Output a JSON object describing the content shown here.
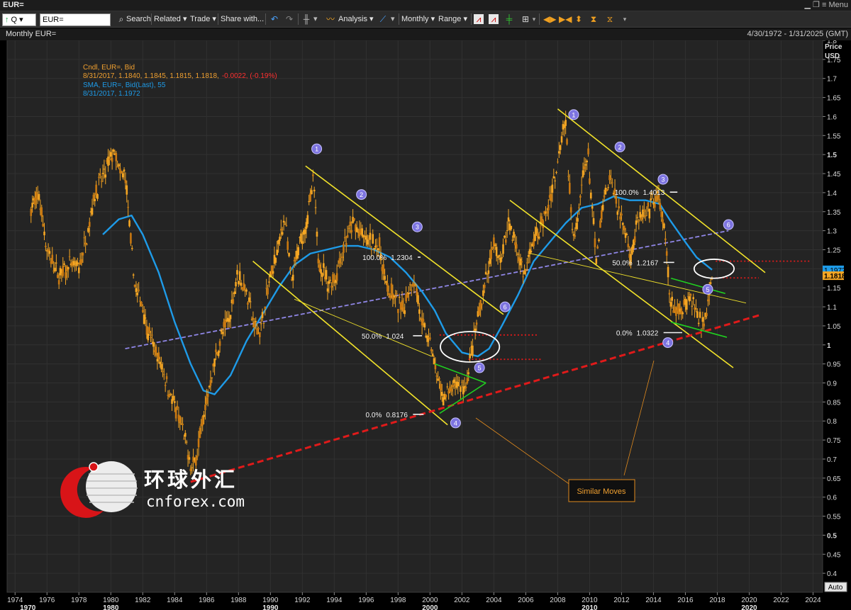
{
  "window": {
    "title": "EUR=",
    "menu_label": "Menu"
  },
  "toolbar": {
    "ric_value": "EUR=",
    "search_label": "Search",
    "related_label": "Related",
    "trade_label": "Trade",
    "share_label": "Share with...",
    "analysis_label": "Analysis",
    "interval_label": "Monthly",
    "range_label": "Range"
  },
  "panel": {
    "title": "Monthly EUR=",
    "date_range": "4/30/1972 - 1/31/2025 (GMT)",
    "auto_label": "Auto"
  },
  "legend": {
    "line1": "Cndl, EUR=, Bid",
    "line2_prefix": "8/31/2017, 1.1840, 1.1845, 1.1815, 1.1818,",
    "line2_change": "-0.0022, (-0.19%)",
    "line3": "SMA, EUR=, Bid(Last),  55",
    "line4": "8/31/2017, 1.1972"
  },
  "colors": {
    "background": "#000000",
    "plot_bg": "#242424",
    "price_series": "#f5a623",
    "sma_series": "#1e9be8",
    "channel": "#f2e32a",
    "support": "#e01a1a",
    "midline": "#8f86e6",
    "wedge": "#20d020",
    "wave_badge": "#7d74e0",
    "callout": "#e08a1e"
  },
  "watermark": {
    "chinese": "环球外汇",
    "latin": "cnforex.com"
  },
  "callout": {
    "label": "Similar Moves"
  },
  "chart_data": {
    "type": "candlestick",
    "interval": "monthly",
    "ylabel": "Price",
    "yunit": "USD",
    "ylim": [
      0.35,
      1.8
    ],
    "xlim": [
      1973.5,
      2024.6
    ],
    "y_ticks": [
      0.4,
      0.45,
      0.5,
      0.55,
      0.6,
      0.65,
      0.7,
      0.75,
      0.8,
      0.85,
      0.9,
      0.95,
      1,
      1.05,
      1.1,
      1.15,
      1.2,
      1.25,
      1.3,
      1.35,
      1.4,
      1.45,
      1.5,
      1.55,
      1.6,
      1.65,
      1.7,
      1.75,
      1.8
    ],
    "y_tick_labels": [
      "0.4",
      "0.45",
      "0.5",
      "0.55",
      "0.6",
      "0.65",
      "0.7",
      "0.75",
      "0.8",
      "0.85",
      "0.9",
      "0.95",
      "1",
      "1.05",
      "1.1",
      "1.15",
      "1.2",
      "1.25",
      "1.3",
      "1.35",
      "1.4",
      "1.45",
      "1.5",
      "1.55",
      "1.6",
      "1.65",
      "1.7",
      "1.75",
      "1.8"
    ],
    "y_bold_ticks": [
      0.5,
      1,
      1.5
    ],
    "x_ticks": [
      1974,
      1976,
      1978,
      1980,
      1982,
      1984,
      1986,
      1988,
      1990,
      1992,
      1994,
      1996,
      1998,
      2000,
      2002,
      2004,
      2006,
      2008,
      2010,
      2012,
      2014,
      2016,
      2018,
      2020,
      2022,
      2024
    ],
    "x_tick_labels": [
      "1974",
      "1976",
      "1978",
      "1980",
      "1982",
      "1984",
      "1986",
      "1988",
      "1990",
      "1992",
      "1994",
      "1996",
      "1998",
      "2000",
      "2002",
      "2004",
      "2006",
      "2008",
      "2010",
      "2012",
      "2014",
      "2016",
      "2018",
      "2020",
      "2022",
      "2024"
    ],
    "x_major": [
      {
        "x": 1970,
        "label": "1970",
        "at": 1974.8
      },
      {
        "x": 1980,
        "label": "1980"
      },
      {
        "x": 1990,
        "label": "1990"
      },
      {
        "x": 2000,
        "label": "2000"
      },
      {
        "x": 2010,
        "label": "2010"
      },
      {
        "x": 2020,
        "label": "2020"
      }
    ],
    "series": [
      {
        "name": "EUR=",
        "kind": "candle",
        "points": [
          [
            1975.0,
            1.36
          ],
          [
            1975.5,
            1.39
          ],
          [
            1976.0,
            1.25
          ],
          [
            1976.7,
            1.18
          ],
          [
            1977.5,
            1.21
          ],
          [
            1978.0,
            1.2
          ],
          [
            1978.5,
            1.29
          ],
          [
            1979.0,
            1.4
          ],
          [
            1979.5,
            1.44
          ],
          [
            1979.8,
            1.47
          ],
          [
            1980.2,
            1.51
          ],
          [
            1980.6,
            1.44
          ],
          [
            1980.9,
            1.45
          ],
          [
            1981.3,
            1.24
          ],
          [
            1981.6,
            1.13
          ],
          [
            1981.9,
            1.12
          ],
          [
            1982.3,
            1.04
          ],
          [
            1982.8,
            0.98
          ],
          [
            1983.3,
            0.93
          ],
          [
            1983.8,
            0.86
          ],
          [
            1984.4,
            0.79
          ],
          [
            1984.8,
            0.72
          ],
          [
            1985.1,
            0.67
          ],
          [
            1985.4,
            0.72
          ],
          [
            1985.9,
            0.83
          ],
          [
            1986.4,
            0.94
          ],
          [
            1986.9,
            1.02
          ],
          [
            1987.5,
            1.08
          ],
          [
            1987.9,
            1.19
          ],
          [
            1988.5,
            1.14
          ],
          [
            1989.0,
            1.05
          ],
          [
            1989.4,
            1.04
          ],
          [
            1989.9,
            1.16
          ],
          [
            1990.4,
            1.24
          ],
          [
            1990.9,
            1.34
          ],
          [
            1991.3,
            1.16
          ],
          [
            1991.8,
            1.26
          ],
          [
            1992.3,
            1.33
          ],
          [
            1992.7,
            1.43
          ],
          [
            1993.0,
            1.23
          ],
          [
            1993.6,
            1.16
          ],
          [
            1994.1,
            1.18
          ],
          [
            1994.6,
            1.26
          ],
          [
            1995.2,
            1.32
          ],
          [
            1995.8,
            1.28
          ],
          [
            1996.3,
            1.27
          ],
          [
            1996.8,
            1.26
          ],
          [
            1997.3,
            1.15
          ],
          [
            1997.8,
            1.12
          ],
          [
            1998.3,
            1.09
          ],
          [
            1998.8,
            1.17
          ],
          [
            1999.1,
            1.16
          ],
          [
            1999.5,
            1.05
          ],
          [
            2000.0,
            1.01
          ],
          [
            2000.4,
            0.92
          ],
          [
            2000.8,
            0.86
          ],
          [
            2001.3,
            0.88
          ],
          [
            2001.8,
            0.9
          ],
          [
            2002.2,
            0.88
          ],
          [
            2002.6,
            0.98
          ],
          [
            2003.0,
            1.07
          ],
          [
            2003.5,
            1.17
          ],
          [
            2004.0,
            1.26
          ],
          [
            2004.5,
            1.22
          ],
          [
            2004.9,
            1.33
          ],
          [
            2005.4,
            1.26
          ],
          [
            2005.9,
            1.18
          ],
          [
            2006.4,
            1.26
          ],
          [
            2006.9,
            1.31
          ],
          [
            2007.4,
            1.36
          ],
          [
            2007.9,
            1.46
          ],
          [
            2008.3,
            1.57
          ],
          [
            2008.5,
            1.59
          ],
          [
            2008.8,
            1.36
          ],
          [
            2009.1,
            1.28
          ],
          [
            2009.6,
            1.45
          ],
          [
            2009.9,
            1.5
          ],
          [
            2010.4,
            1.22
          ],
          [
            2010.9,
            1.38
          ],
          [
            2011.3,
            1.44
          ],
          [
            2011.8,
            1.36
          ],
          [
            2012.3,
            1.29
          ],
          [
            2012.6,
            1.23
          ],
          [
            2013.0,
            1.33
          ],
          [
            2013.6,
            1.34
          ],
          [
            2014.0,
            1.38
          ],
          [
            2014.4,
            1.38
          ],
          [
            2014.8,
            1.25
          ],
          [
            2015.0,
            1.13
          ],
          [
            2015.3,
            1.08
          ],
          [
            2015.8,
            1.1
          ],
          [
            2016.3,
            1.13
          ],
          [
            2016.8,
            1.08
          ],
          [
            2017.0,
            1.05
          ],
          [
            2017.3,
            1.09
          ],
          [
            2017.6,
            1.18
          ],
          [
            2017.67,
            1.1818
          ]
        ]
      },
      {
        "name": "SMA 55",
        "kind": "line",
        "points": [
          [
            1979.5,
            1.29
          ],
          [
            1980.5,
            1.33
          ],
          [
            1981.3,
            1.34
          ],
          [
            1982.0,
            1.29
          ],
          [
            1983.0,
            1.19
          ],
          [
            1984.0,
            1.06
          ],
          [
            1985.0,
            0.95
          ],
          [
            1985.8,
            0.88
          ],
          [
            1986.5,
            0.87
          ],
          [
            1987.5,
            0.92
          ],
          [
            1988.5,
            1.01
          ],
          [
            1989.5,
            1.08
          ],
          [
            1990.5,
            1.15
          ],
          [
            1991.5,
            1.21
          ],
          [
            1992.5,
            1.24
          ],
          [
            1993.5,
            1.25
          ],
          [
            1994.5,
            1.26
          ],
          [
            1995.5,
            1.26
          ],
          [
            1996.5,
            1.25
          ],
          [
            1997.5,
            1.23
          ],
          [
            1998.5,
            1.19
          ],
          [
            1999.5,
            1.14
          ],
          [
            2000.3,
            1.09
          ],
          [
            2001.0,
            1.03
          ],
          [
            2002.0,
            0.98
          ],
          [
            2003.0,
            0.97
          ],
          [
            2003.7,
            0.99
          ],
          [
            2004.5,
            1.05
          ],
          [
            2005.5,
            1.13
          ],
          [
            2006.5,
            1.22
          ],
          [
            2007.5,
            1.27
          ],
          [
            2008.5,
            1.32
          ],
          [
            2009.5,
            1.36
          ],
          [
            2010.5,
            1.37
          ],
          [
            2011.5,
            1.39
          ],
          [
            2012.5,
            1.38
          ],
          [
            2013.5,
            1.38
          ],
          [
            2014.4,
            1.37
          ],
          [
            2015.0,
            1.33
          ],
          [
            2016.0,
            1.27
          ],
          [
            2016.7,
            1.23
          ],
          [
            2017.67,
            1.1972
          ]
        ]
      }
    ],
    "last_price_label": "1.1818",
    "sma_last_label": "1.1972",
    "fib_levels": [
      {
        "label": "100.0%",
        "value_label": "1.2304",
        "x0": 1995.5,
        "x1": 1999.4,
        "y": 1.2304
      },
      {
        "label": "50.0%",
        "value_label": "1.024",
        "x0": 1995.2,
        "x1": 1999.5,
        "y": 1.024
      },
      {
        "label": "0.0%",
        "value_label": "0.8176",
        "x0": 1995.2,
        "x1": 1999.6,
        "y": 0.8176
      },
      {
        "label": "100.0%",
        "value_label": "1.4013",
        "x0": 2011.3,
        "x1": 2015.5,
        "y": 1.4013
      },
      {
        "label": "50.0%",
        "value_label": "1.2167",
        "x0": 2010.9,
        "x1": 2015.3,
        "y": 1.2167
      },
      {
        "label": "0.0%",
        "value_label": "1.0322",
        "x0": 2010.9,
        "x1": 2015.8,
        "y": 1.0322
      }
    ],
    "waves": [
      {
        "label": "1",
        "x": 1992.9,
        "y": 1.515
      },
      {
        "label": "2",
        "x": 1995.7,
        "y": 1.395
      },
      {
        "label": "3",
        "x": 1999.2,
        "y": 1.31
      },
      {
        "label": "4",
        "x": 2001.6,
        "y": 0.795
      },
      {
        "label": "5",
        "x": 2003.1,
        "y": 0.94
      },
      {
        "label": "6",
        "x": 2004.7,
        "y": 1.1
      },
      {
        "label": "1",
        "x": 2009.0,
        "y": 1.605
      },
      {
        "label": "2",
        "x": 2011.9,
        "y": 1.52
      },
      {
        "label": "3",
        "x": 2014.6,
        "y": 1.435
      },
      {
        "label": "4",
        "x": 2014.9,
        "y": 1.006
      },
      {
        "label": "5",
        "x": 2017.4,
        "y": 1.146
      },
      {
        "label": "6",
        "x": 2018.7,
        "y": 1.316
      }
    ],
    "trendlines": [
      {
        "kind": "channel",
        "x1": 1992.2,
        "y1": 1.47,
        "x2": 2004.6,
        "y2": 1.08
      },
      {
        "kind": "channel",
        "x1": 1988.9,
        "y1": 1.22,
        "x2": 2001.1,
        "y2": 0.79
      },
      {
        "kind": "channel",
        "x1": 2008.0,
        "y1": 1.62,
        "x2": 2021.0,
        "y2": 1.19
      },
      {
        "kind": "channel",
        "x1": 2005.0,
        "y1": 1.38,
        "x2": 2019.0,
        "y2": 0.94
      },
      {
        "kind": "thin",
        "x1": 1991.5,
        "y1": 1.12,
        "x2": 2000.1,
        "y2": 0.97
      },
      {
        "kind": "thin",
        "x1": 2006.3,
        "y1": 1.24,
        "x2": 2019.8,
        "y2": 1.11
      },
      {
        "kind": "support",
        "x1": 1985.0,
        "y1": 0.64,
        "x2": 2020.8,
        "y2": 1.08
      },
      {
        "kind": "midline",
        "x1": 1980.9,
        "y1": 0.99,
        "x2": 2018.7,
        "y2": 1.3
      },
      {
        "kind": "wedge",
        "x1": 2000.3,
        "y1": 0.95,
        "x2": 2003.5,
        "y2": 0.9
      },
      {
        "kind": "wedge",
        "x1": 2003.5,
        "y1": 0.9,
        "x2": 2000.6,
        "y2": 0.82
      },
      {
        "kind": "wedge",
        "x1": 2015.1,
        "y1": 1.175,
        "x2": 2018.5,
        "y2": 1.135
      },
      {
        "kind": "wedge",
        "x1": 2015.1,
        "y1": 1.06,
        "x2": 2018.6,
        "y2": 1.02
      }
    ],
    "dotted_levels": [
      {
        "x0": 2000.6,
        "x1": 2006.7,
        "y": 1.026
      },
      {
        "x0": 2002.4,
        "x1": 2007.0,
        "y": 0.962
      },
      {
        "x0": 2017.9,
        "x1": 2023.9,
        "y": 1.22
      },
      {
        "x0": 2017.9,
        "x1": 2020.6,
        "y": 1.176
      }
    ],
    "highlight_ellipses": [
      {
        "cx": 2002.5,
        "cy": 0.995,
        "rx": 1.85,
        "ry": 0.04
      },
      {
        "cx": 2017.8,
        "cy": 1.2,
        "rx": 1.25,
        "ry": 0.025
      }
    ]
  }
}
